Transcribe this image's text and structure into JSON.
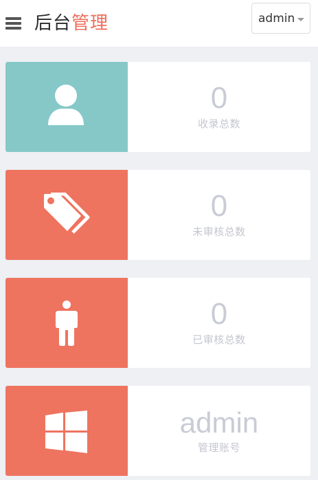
{
  "header": {
    "menu_icon": "hamburger-menu-icon",
    "title_dark": "后台",
    "title_accent": "管理",
    "user_select": {
      "value": "admin",
      "icon": "caret-down-icon"
    }
  },
  "stats": [
    {
      "value": "0",
      "label": "收录总数",
      "icon": "user-icon",
      "color": "#86c8c8"
    },
    {
      "value": "0",
      "label": "未审核总数",
      "icon": "tags-icon",
      "color": "#ee7460"
    },
    {
      "value": "0",
      "label": "已审核总数",
      "icon": "person-standing-icon",
      "color": "#ee7460"
    },
    {
      "value": "admin",
      "label": "管理账号",
      "icon": "windows-icon",
      "color": "#ee7460"
    }
  ]
}
